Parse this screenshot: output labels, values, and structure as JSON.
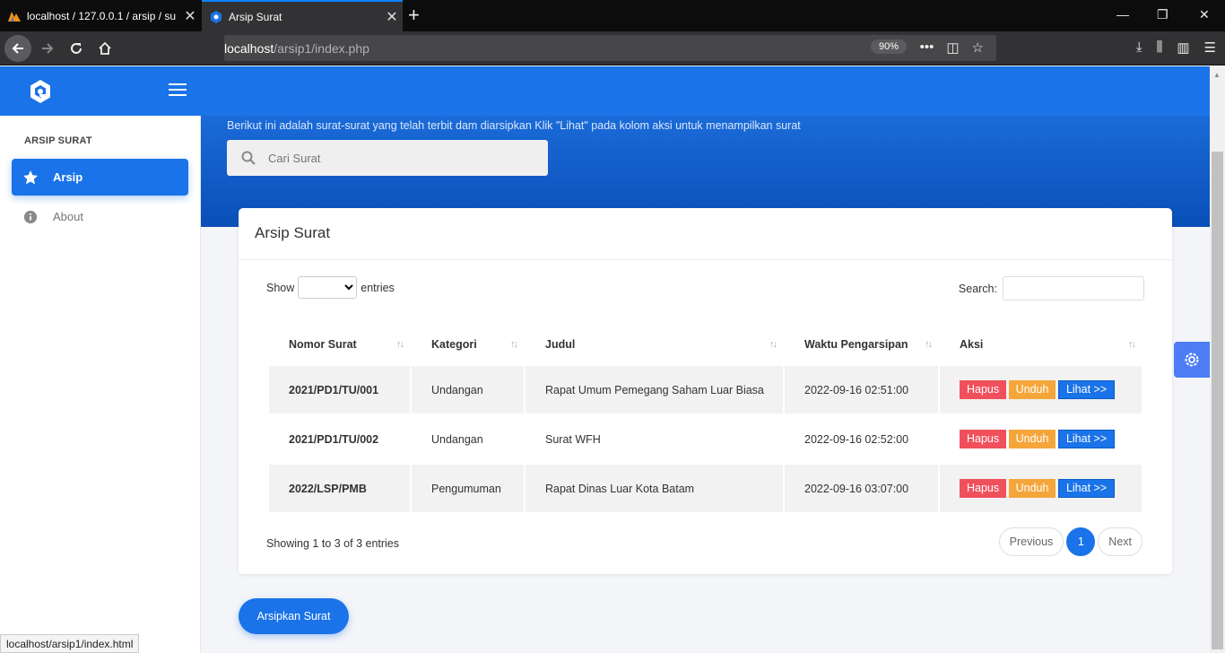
{
  "browser": {
    "tabs": [
      {
        "title": "localhost / 127.0.0.1 / arsip / su",
        "active": false
      },
      {
        "title": "Arsip Surat",
        "active": true
      }
    ],
    "url_host": "localhost",
    "url_path": "/arsip1/index.php",
    "zoom": "90%",
    "status_url": "localhost/arsip1/index.html",
    "colors": {
      "tab_accent": "#0a84ff",
      "chrome_bg": "#0c0c0d"
    }
  },
  "app": {
    "colors": {
      "primary": "#1a73e8",
      "danger": "#f0505c",
      "warning": "#f5a63a"
    }
  },
  "sidebar": {
    "heading": "ARSIP SURAT",
    "items": [
      {
        "label": "Arsip",
        "icon": "star-icon",
        "active": true
      },
      {
        "label": "About",
        "icon": "info-icon",
        "active": false
      }
    ]
  },
  "hero": {
    "description": "Berikut ini adalah surat-surat yang telah terbit dam diarsipkan Klik \"Lihat\" pada kolom aksi untuk menampilkan surat",
    "search_placeholder": "Cari Surat"
  },
  "card": {
    "title": "Arsip Surat",
    "show_label": "Show",
    "entries_label": "entries",
    "search_label": "Search:",
    "columns": [
      "Nomor Surat",
      "Kategori",
      "Judul",
      "Waktu Pengarsipan",
      "Aksi"
    ],
    "rows": [
      {
        "nomor": "2021/PD1/TU/001",
        "kategori": "Undangan",
        "judul": "Rapat Umum Pemegang Saham Luar Biasa",
        "waktu": "2022-09-16 02:51:00"
      },
      {
        "nomor": "2021/PD1/TU/002",
        "kategori": "Undangan",
        "judul": "Surat WFH",
        "waktu": "2022-09-16 02:52:00"
      },
      {
        "nomor": "2022/LSP/PMB",
        "kategori": "Pengumuman",
        "judul": "Rapat Dinas Luar Kota Batam",
        "waktu": "2022-09-16 03:07:00"
      }
    ],
    "actions": {
      "delete": "Hapus",
      "download": "Unduh",
      "view": "Lihat >>"
    },
    "info": "Showing 1 to 3 of 3 entries",
    "pager": {
      "previous": "Previous",
      "current": "1",
      "next": "Next"
    }
  },
  "archive_button": "Arsipkan Surat"
}
